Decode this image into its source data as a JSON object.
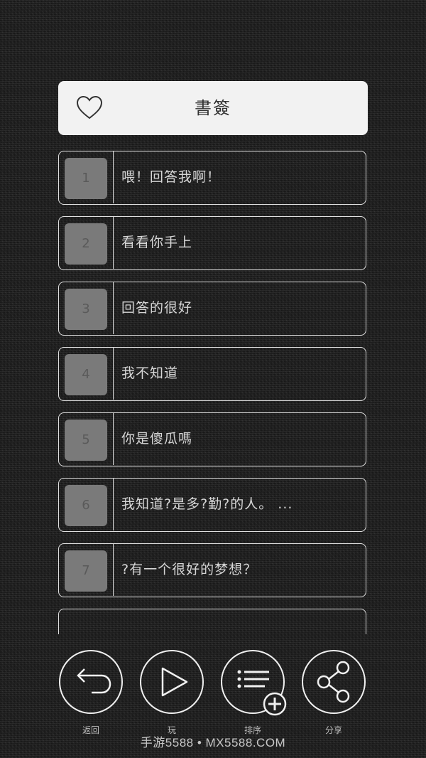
{
  "header": {
    "title": "書簽",
    "icon": "heart-icon"
  },
  "items": [
    {
      "num": "1",
      "text": "喂！回答我啊！"
    },
    {
      "num": "2",
      "text": "看看你手上"
    },
    {
      "num": "3",
      "text": "回答的很好"
    },
    {
      "num": "4",
      "text": "我不知道"
    },
    {
      "num": "5",
      "text": "你是傻瓜嗎"
    },
    {
      "num": "6",
      "text": "我知道?是多?勤?的人。  ..."
    },
    {
      "num": "7",
      "text": "?有一个很好的梦想？"
    }
  ],
  "toolbar": {
    "back_label": "返回",
    "play_label": "玩",
    "sort_label": "排序",
    "share_label": "分享"
  },
  "watermark": "手游5588 • MX5588.COM",
  "colors": {
    "card_bg": "#f2f2f2",
    "number_box": "#7a7a7a",
    "outline": "#e0e0e0"
  }
}
